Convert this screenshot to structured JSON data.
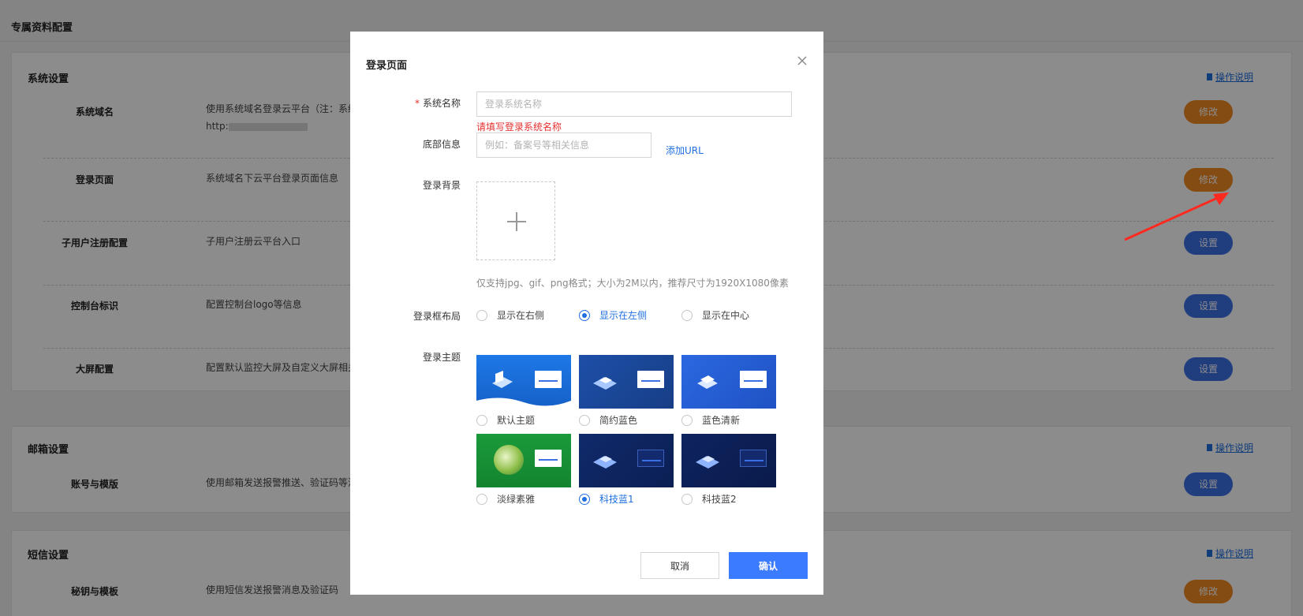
{
  "page": {
    "title": "专属资料配置"
  },
  "sections": {
    "system": {
      "title": "系统设置",
      "help": "操作说明",
      "rows": [
        {
          "name": "系统域名",
          "desc": "使用系统域名登录云平台（注：系统",
          "desc2": "http:",
          "button": "修改"
        },
        {
          "name": "登录页面",
          "desc": "系统域名下云平台登录页面信息",
          "button": "修改"
        },
        {
          "name": "子用户注册配置",
          "desc": "子用户注册云平台入口",
          "button": "设置"
        },
        {
          "name": "控制台标识",
          "desc": "配置控制台logo等信息",
          "button": "设置"
        },
        {
          "name": "大屏配置",
          "desc": "配置默认监控大屏及自定义大屏相关信",
          "button": "设置"
        }
      ]
    },
    "mail": {
      "title": "邮箱设置",
      "help": "操作说明",
      "rows": [
        {
          "name": "账号与模版",
          "desc": "使用邮箱发送报警推送、验证码等消息",
          "button": "设置"
        }
      ]
    },
    "sms": {
      "title": "短信设置",
      "help": "操作说明",
      "rows": [
        {
          "name": "秘钥与模板",
          "desc": "使用短信发送报警消息及验证码",
          "button": "修改"
        }
      ]
    }
  },
  "modal": {
    "title": "登录页面",
    "fields": {
      "system_name": {
        "label": "系统名称",
        "required": "*",
        "placeholder": "登录系统名称",
        "error": "请填写登录系统名称"
      },
      "footer": {
        "label": "底部信息",
        "placeholder": "例如：备案号等相关信息",
        "add_url": "添加URL"
      },
      "background": {
        "label": "登录背景",
        "hint": "仅支持jpg、gif、png格式；大小为2M以内，推荐尺寸为1920X1080像素"
      },
      "layout": {
        "label": "登录框布局",
        "options": [
          "显示在右侧",
          "显示在左侧",
          "显示在中心"
        ],
        "selected": "显示在左侧"
      },
      "theme": {
        "label": "登录主题",
        "options": [
          "默认主题",
          "简约蓝色",
          "蓝色清新",
          "淡绿素雅",
          "科技蓝1",
          "科技蓝2"
        ],
        "selected": "科技蓝1"
      }
    },
    "buttons": {
      "cancel": "取消",
      "confirm": "确认"
    }
  },
  "colors": {
    "primary": "#3b7bff",
    "orange": "#f08a24",
    "error": "#e5312f",
    "link": "#1f6fe0"
  }
}
